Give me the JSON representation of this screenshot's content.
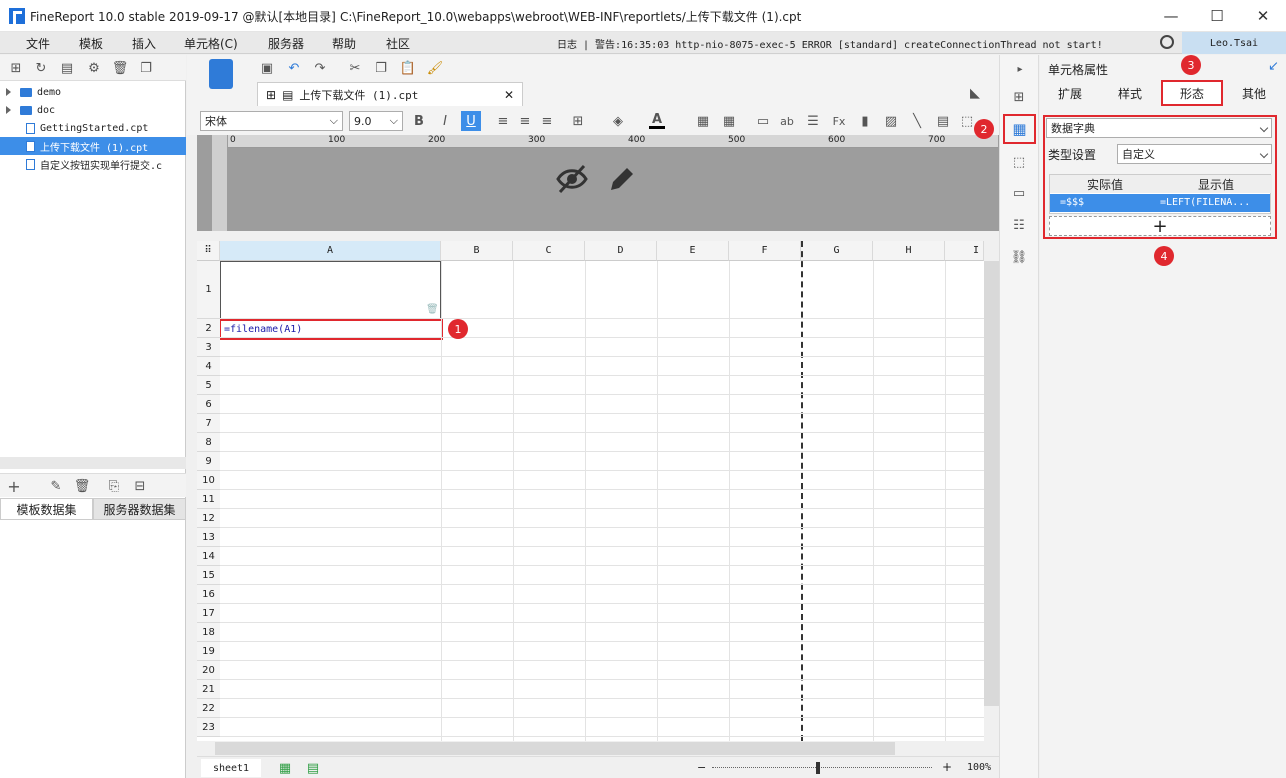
{
  "window": {
    "title": "FineReport 10.0 stable 2019-09-17 @默认[本地目录]",
    "path": "C:\\FineReport_10.0\\webapps\\webroot\\WEB-INF\\reportlets/上传下载文件 (1).cpt",
    "minimize": "—",
    "maximize": "☐",
    "close": "✕"
  },
  "menu": {
    "items": [
      "文件",
      "模板",
      "插入",
      "单元格(C)",
      "服务器",
      "帮助",
      "社区"
    ],
    "log": "日志 | 警告:16:35:03 http-nio-8075-exec-5 ERROR [standard] createConnectionThread not start!",
    "user": "Leo.Tsai"
  },
  "tree": {
    "items": [
      {
        "label": "demo",
        "type": "folder"
      },
      {
        "label": "doc",
        "type": "folder"
      },
      {
        "label": "GettingStarted.cpt",
        "type": "file"
      },
      {
        "label": "上传下载文件 (1).cpt",
        "type": "file",
        "selected": true
      },
      {
        "label": "自定义按钮实现单行提交.c",
        "type": "file"
      }
    ]
  },
  "dataset_tabs": [
    "模板数据集",
    "服务器数据集"
  ],
  "editor": {
    "tab_label": "上传下载文件 (1).cpt",
    "font_name": "宋体",
    "font_size": "9.0",
    "ruler_marks": [
      "0",
      "100",
      "200",
      "300",
      "400",
      "500",
      "600",
      "700"
    ]
  },
  "grid": {
    "columns": [
      "A",
      "B",
      "C",
      "D",
      "E",
      "F",
      "G",
      "H",
      "I"
    ],
    "rows": [
      "1",
      "2",
      "3",
      "4",
      "5",
      "6",
      "7",
      "8",
      "9",
      "10",
      "11",
      "12",
      "13",
      "14",
      "15",
      "16",
      "17",
      "18",
      "19",
      "20",
      "21",
      "22",
      "23"
    ],
    "cell_a2": "=filename(A1)"
  },
  "sheet": {
    "name": "sheet1",
    "zoom": "100%"
  },
  "props": {
    "title": "单元格属性",
    "tabs": [
      "扩展",
      "样式",
      "形态",
      "其他"
    ],
    "active_tab": "形态",
    "widget_type": "数据字典",
    "type_setting_label": "类型设置",
    "type_setting_value": "自定义",
    "col_actual": "实际值",
    "col_display": "显示值",
    "row_actual": "=$$$",
    "row_display": "=LEFT(FILENA...",
    "add": "+"
  },
  "badges": [
    "1",
    "2",
    "3",
    "4"
  ],
  "colors": {
    "accent": "#3d8ee8",
    "highlight": "#e0282e",
    "selection": "#3d8ee8"
  }
}
